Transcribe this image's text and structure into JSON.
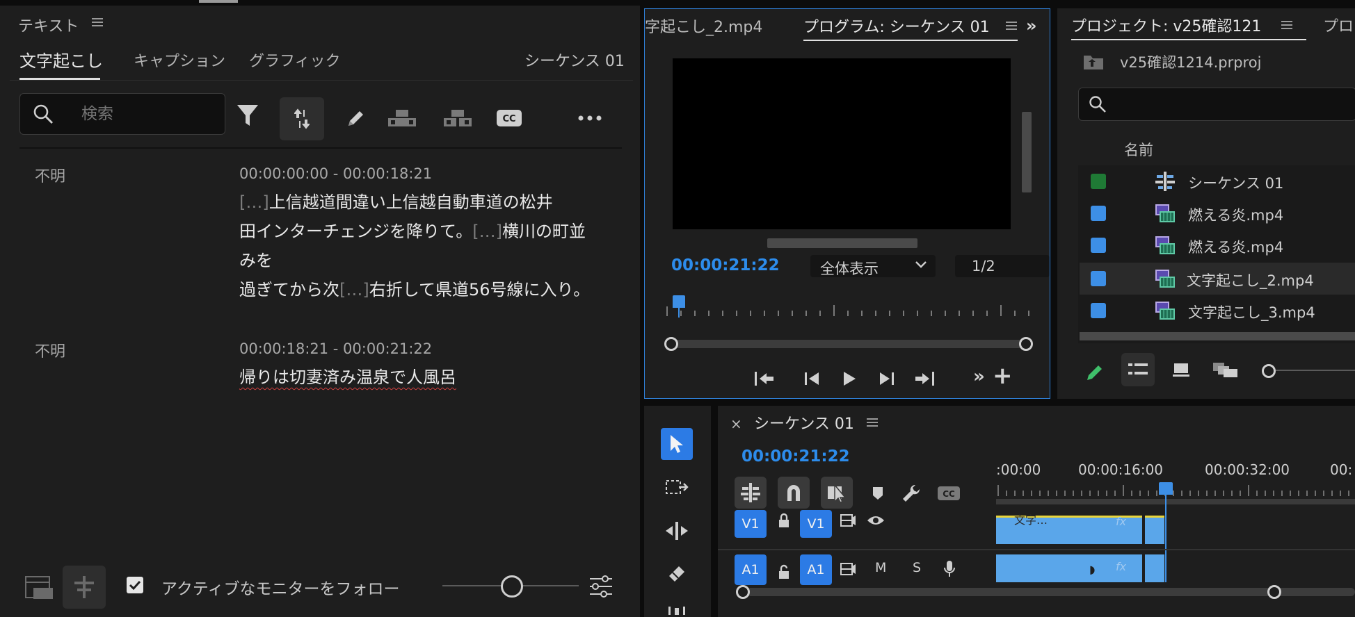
{
  "text_panel": {
    "title": "テキスト",
    "tabs": [
      {
        "label": "文字起こし",
        "active": true
      },
      {
        "label": "キャプション",
        "active": false
      },
      {
        "label": "グラフィック",
        "active": false
      }
    ],
    "sequence_label": "シーケンス 01",
    "search_placeholder": "検索",
    "segments": [
      {
        "speaker": "不明",
        "timecode": "00:00:00:00 - 00:00:18:21",
        "lines": [
          [
            {
              "m": "[…]"
            },
            {
              "t": "上信越道間違い上信越自動車道の松井"
            }
          ],
          [
            {
              "t": "田インターチェンジを降りて。"
            },
            {
              "m": "[…]"
            },
            {
              "t": "横川の町並みを"
            }
          ],
          [
            {
              "t": "過ぎてから次"
            },
            {
              "m": "[…]"
            },
            {
              "t": "右折して県道56号線に入り。"
            }
          ]
        ]
      },
      {
        "speaker": "不明",
        "timecode": "00:00:18:21 - 00:00:21:22",
        "lines": [
          [
            {
              "t": "帰りは切妻済み温泉で人風呂"
            }
          ]
        ]
      }
    ],
    "follow_monitor_label": "アクティブなモニターをフォロー",
    "follow_monitor_checked": true
  },
  "program_monitor": {
    "source_tab": "字起こし_2.mp4",
    "tab": "プログラム: シーケンス 01",
    "timecode": "00:00:21:22",
    "zoom": "全体表示",
    "resolution": "1/2"
  },
  "project_panel": {
    "tab": "プロジェクト: v25確認121",
    "next_tab": "プロ",
    "file": "v25確認1214.prproj",
    "column_name": "名前",
    "items": [
      {
        "name": "シーケンス 01",
        "color": "#1f7a35",
        "kind": "sequence"
      },
      {
        "name": "燃える炎.mp4",
        "color": "#3d8fe6",
        "kind": "clip"
      },
      {
        "name": "燃える炎.mp4",
        "color": "#3d8fe6",
        "kind": "clip"
      },
      {
        "name": "文字起こし_2.mp4",
        "color": "#3d8fe6",
        "kind": "clip",
        "selected": true
      },
      {
        "name": "文字起こし_3.mp4",
        "color": "#3d8fe6",
        "kind": "clip"
      }
    ]
  },
  "timeline": {
    "tab": "シーケンス 01",
    "close": "×",
    "timecode": "00:00:21:22",
    "ruler": [
      ":00:00",
      "00:00:16:00",
      "00:00:32:00",
      "00:"
    ],
    "tracks": {
      "video": {
        "target": "V1",
        "source": "V1"
      },
      "audio": {
        "target": "A1",
        "source": "A1",
        "m": "M",
        "s": "S"
      }
    },
    "clip_label": "文字…"
  },
  "colors": {
    "accent_blue": "#2d8ceb",
    "track_blue": "#2c7be5",
    "clip_blue": "#5aa6ea"
  }
}
